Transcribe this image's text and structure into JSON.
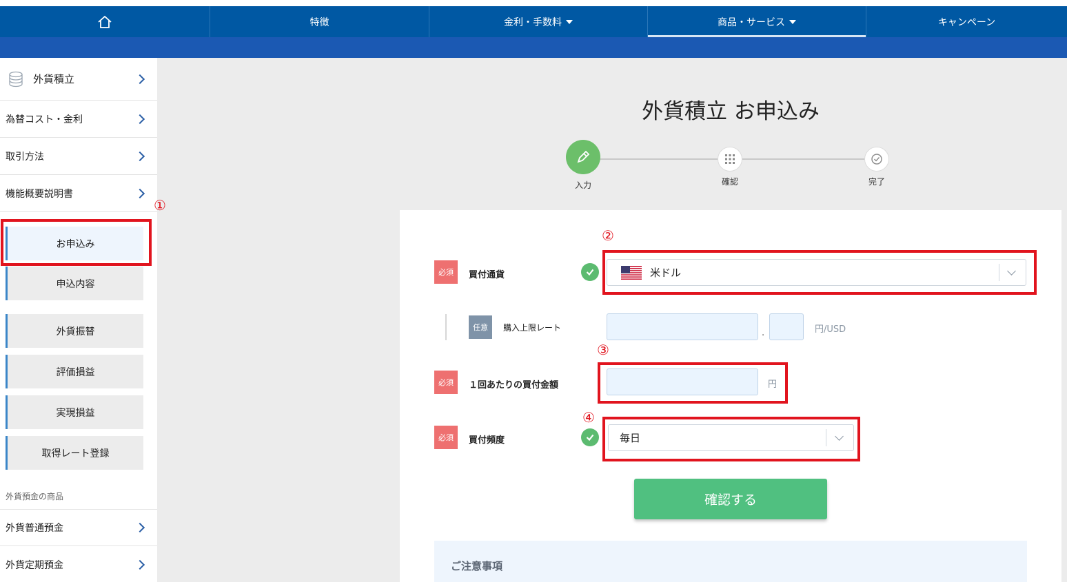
{
  "nav": {
    "items": [
      {
        "label": "",
        "icon": "home-icon"
      },
      {
        "label": "特徴"
      },
      {
        "label": "金利・手数料",
        "caret": true
      },
      {
        "label": "商品・サービス",
        "caret": true,
        "active": true
      },
      {
        "label": "キャンペーン"
      }
    ]
  },
  "sidebar": {
    "items": [
      {
        "label": "外貨積立",
        "icon": "coin-stack-icon"
      },
      {
        "label": "為替コスト・金利"
      },
      {
        "label": "取引方法"
      },
      {
        "label": "機能概要説明書"
      }
    ],
    "sub_items": [
      {
        "label": "お申込み",
        "active": true
      },
      {
        "label": "申込内容"
      },
      {
        "label": "外貨振替"
      },
      {
        "label": "評価損益"
      },
      {
        "label": "実現損益"
      },
      {
        "label": "取得レート登録"
      }
    ],
    "section_caption": "外貨預金の商品",
    "bottom_items": [
      {
        "label": "外貨普通預金"
      },
      {
        "label": "外貨定期預金"
      }
    ]
  },
  "page": {
    "title": "外貨積立 お申込み"
  },
  "stepper": {
    "steps": [
      {
        "label": "入力",
        "active": true,
        "icon": "pencil-icon"
      },
      {
        "label": "確認",
        "icon": "grid-icon"
      },
      {
        "label": "完了",
        "icon": "check-circle-icon"
      }
    ]
  },
  "form": {
    "required_badge": "必須",
    "optional_badge": "任意",
    "currency": {
      "label": "買付通貨",
      "value": "米ドル",
      "flag": "us-flag-icon"
    },
    "limit_rate": {
      "label": "購入上限レート",
      "int_value": "",
      "dec_value": "",
      "separator": ".",
      "unit": "円/USD"
    },
    "amount": {
      "label": "１回あたりの買付金額",
      "value": "",
      "unit": "円"
    },
    "frequency": {
      "label": "買付頻度",
      "value": "毎日"
    },
    "confirm_label": "確認する"
  },
  "notes": {
    "title": "ご注意事項"
  },
  "annotations": {
    "marks": [
      "①",
      "②",
      "③",
      "④"
    ],
    "color": "#e1141e"
  },
  "colors": {
    "nav_bg": "#0058a3",
    "accent_green": "#50c080",
    "required_red": "#ee7070",
    "optional_gray": "#7f93a8"
  }
}
